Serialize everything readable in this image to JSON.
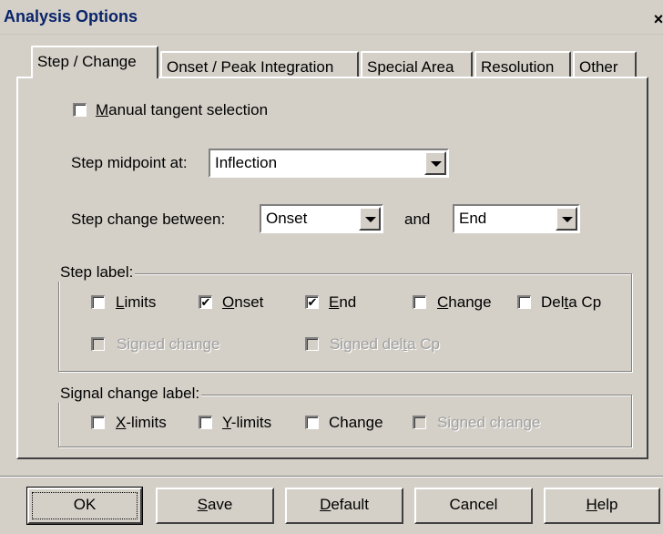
{
  "window": {
    "title": "Analysis Options",
    "close": "×"
  },
  "tabs": [
    {
      "pre": "Step / Change",
      "u": "",
      "post": ""
    },
    {
      "pre": "Onset / Peak Integration",
      "u": "",
      "post": ""
    },
    {
      "pre": "Special Area",
      "u": "",
      "post": ""
    },
    {
      "pre": "Resolution",
      "u": "",
      "post": ""
    },
    {
      "pre": "Other",
      "u": "",
      "post": ""
    }
  ],
  "manual_tangent": {
    "u": "M",
    "rest": "anual tangent selection",
    "checked": false
  },
  "step_midpoint": {
    "label": "Step midpoint at:",
    "value": "Inflection"
  },
  "step_change": {
    "label": "Step change between:",
    "from": "Onset",
    "and": "and",
    "to": "End"
  },
  "step_label_group": {
    "title": "Step label:",
    "limits": {
      "u": "L",
      "rest": "imits",
      "checked": false
    },
    "onset": {
      "u": "O",
      "rest": "nset",
      "checked": true
    },
    "end": {
      "u": "E",
      "rest": "nd",
      "checked": true
    },
    "change": {
      "u": "C",
      "rest": "hange",
      "checked": false
    },
    "delta_cp": {
      "pre": "Del",
      "u": "t",
      "rest": "a Cp",
      "checked": false
    },
    "signed_change": {
      "text": "Signed change",
      "checked": false,
      "disabled": true
    },
    "signed_delta_cp": {
      "pre": "Signed del",
      "u": "t",
      "rest": "a Cp",
      "checked": false,
      "disabled": true
    }
  },
  "signal_group": {
    "title": "Signal change label:",
    "x_limits": {
      "u": "X",
      "rest": "-limits",
      "checked": false
    },
    "y_limits": {
      "u": "Y",
      "rest": "-limits",
      "checked": false
    },
    "change": {
      "text": "Change",
      "checked": false
    },
    "signed_change": {
      "text": "Signed change",
      "checked": false,
      "disabled": true
    }
  },
  "buttons": {
    "ok": "OK",
    "save": {
      "u": "S",
      "rest": "ave"
    },
    "default": {
      "u": "D",
      "rest": "efault"
    },
    "cancel": "Cancel",
    "help": {
      "u": "H",
      "rest": "elp"
    }
  },
  "check_mark": "✔"
}
